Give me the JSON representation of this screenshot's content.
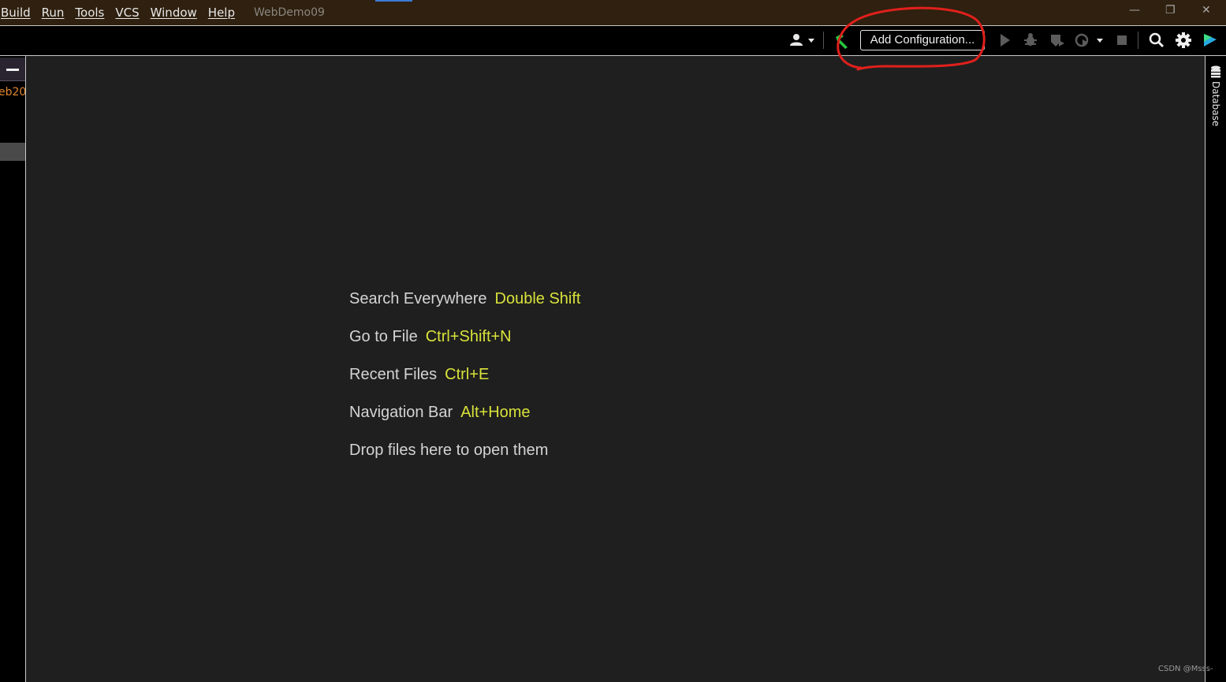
{
  "menu": {
    "items": [
      "Build",
      "Run",
      "Tools",
      "VCS",
      "Window",
      "Help"
    ]
  },
  "project_title": "WebDemo09",
  "window_controls": {
    "minimize": "—",
    "restore": "❐",
    "close": "✕"
  },
  "toolbar": {
    "add_configuration_label": "Add Configuration...",
    "icons": [
      "user-icon",
      "build-hammer-icon",
      "run-icon",
      "debug-icon",
      "coverage-icon",
      "profile-icon",
      "stop-icon",
      "search-icon",
      "gear-icon",
      "plugin-icon"
    ]
  },
  "left_panel": {
    "project_label": "eb20"
  },
  "right_panel": {
    "database_label": "Database"
  },
  "hints": [
    {
      "label": "Search Everywhere",
      "shortcut": "Double Shift"
    },
    {
      "label": "Go to File",
      "shortcut": "Ctrl+Shift+N"
    },
    {
      "label": "Recent Files",
      "shortcut": "Ctrl+E"
    },
    {
      "label": "Navigation Bar",
      "shortcut": "Alt+Home"
    },
    {
      "label": "Drop files here to open them",
      "shortcut": ""
    }
  ],
  "watermark": "CSDN @Msss-",
  "colors": {
    "accent": "#3d7bd4",
    "shortcut": "#d8e23a",
    "project_label": "#e0862c",
    "annotation": "#e0201c"
  }
}
